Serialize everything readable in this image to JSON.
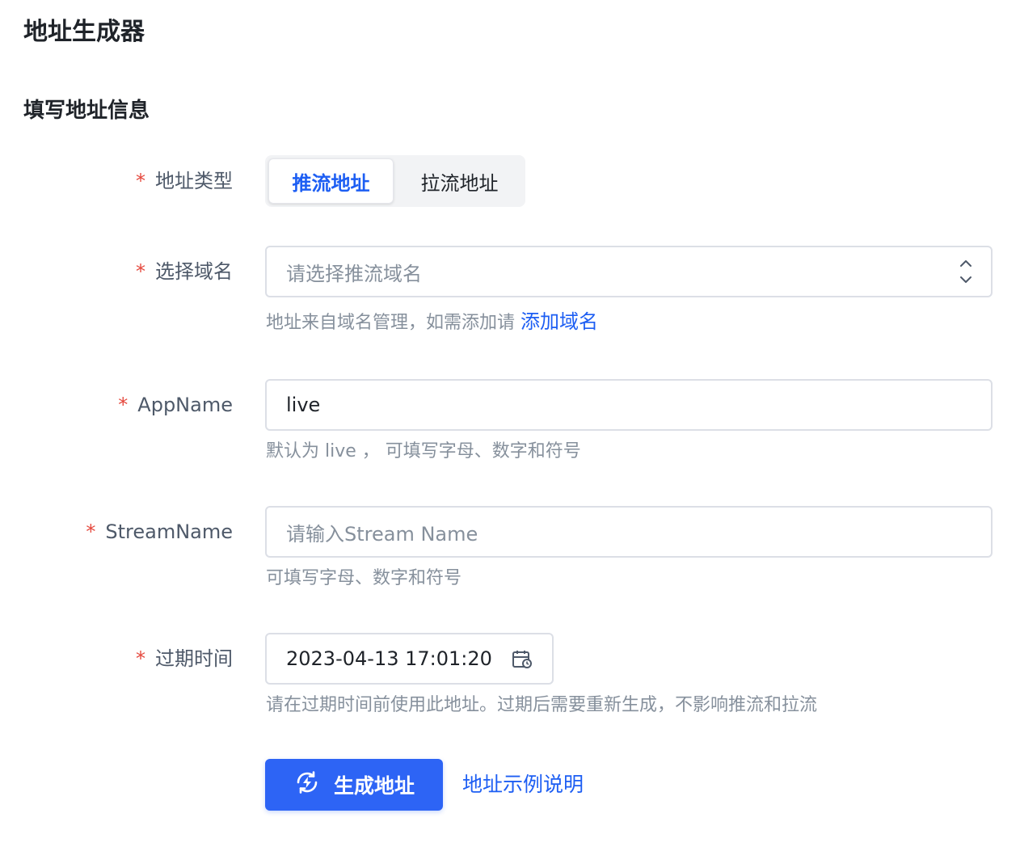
{
  "page": {
    "title": "地址生成器"
  },
  "section": {
    "title": "填写地址信息"
  },
  "required_mark": "*",
  "address_type": {
    "label": "地址类型",
    "options": [
      "推流地址",
      "拉流地址"
    ],
    "selected": "推流地址"
  },
  "domain": {
    "label": "选择域名",
    "placeholder": "请选择推流域名",
    "help_text": "地址来自域名管理，如需添加请",
    "help_link": "添加域名"
  },
  "app_name": {
    "label": "AppName",
    "value": "live",
    "help_text": "默认为 live ， 可填写字母、数字和符号"
  },
  "stream_name": {
    "label": "StreamName",
    "placeholder": "请输入Stream Name",
    "help_text": "可填写字母、数字和符号"
  },
  "expire_time": {
    "label": "过期时间",
    "value": "2023-04-13 17:01:20",
    "help_text": "请在过期时间前使用此地址。过期后需要重新生成，不影响推流和拉流"
  },
  "actions": {
    "generate_label": "生成地址",
    "example_link": "地址示例说明"
  },
  "colors": {
    "primary": "#2d64f5",
    "link": "#1d5ef3",
    "required": "#e5483d",
    "help": "#86909c"
  },
  "icons": {
    "select_arrows": "chevron-up-down-icon",
    "calendar": "calendar-clock-icon",
    "generate": "refresh-bolt-icon"
  }
}
